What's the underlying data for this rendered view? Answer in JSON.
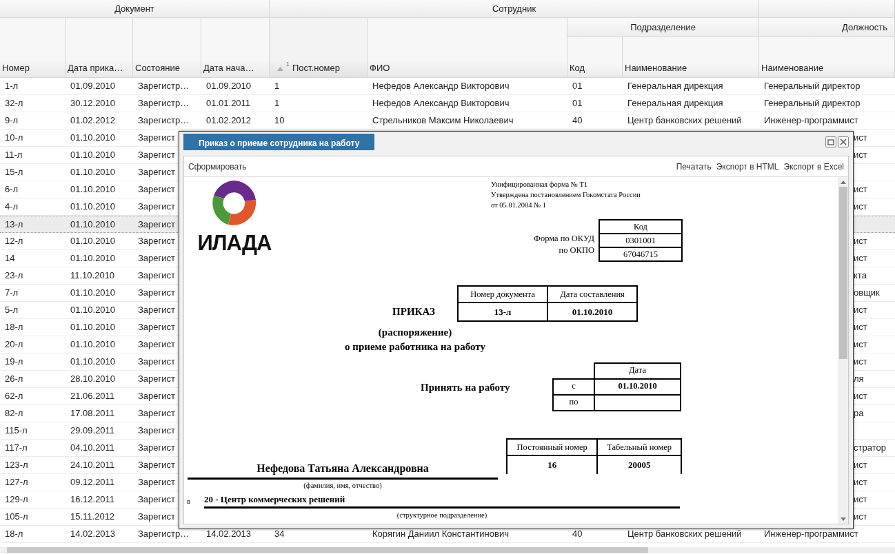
{
  "grid": {
    "groups": {
      "document": "Документ",
      "employee": "Сотрудник",
      "department": "Подразделение",
      "position": "Должность"
    },
    "columns": [
      {
        "label": "Номер",
        "sorted": false
      },
      {
        "label": "Дата прика…",
        "sorted": false
      },
      {
        "label": "Состояние",
        "sorted": false
      },
      {
        "label": "Дата нача…",
        "sorted": false
      },
      {
        "label": "Пост.номер",
        "sorted": true,
        "sort_order": "1"
      },
      {
        "label": "ФИО",
        "sorted": false
      },
      {
        "label": "Код",
        "sorted": false
      },
      {
        "label": "Наименование",
        "sorted": false
      },
      {
        "label": "Наименование",
        "sorted": false
      }
    ],
    "rows": [
      {
        "cells": [
          "1-л",
          "01.09.2010",
          "Зарегистр…",
          "01.09.2010",
          "1",
          "Нефедов Александр Викторович",
          "01",
          "Генеральная дирекция",
          "Генеральный директор"
        ],
        "selected": false
      },
      {
        "cells": [
          "32-л",
          "30.12.2010",
          "Зарегистр…",
          "01.01.2011",
          "1",
          "Нефедов Александр Викторович",
          "01",
          "Генеральная дирекция",
          "Генеральный директор"
        ],
        "selected": false
      },
      {
        "cells": [
          "9-л",
          "01.02.2012",
          "Зарегистр…",
          "01.02.2012",
          "10",
          "Стрельников Максим Николаевич",
          "40",
          "Центр банковских решений",
          "Инженер-программист"
        ],
        "selected": false
      },
      {
        "cells": [
          "10-л",
          "01.10.2010",
          "Зарегист"
        ],
        "tail": "ист",
        "selected": false
      },
      {
        "cells": [
          "11-л",
          "01.10.2010",
          "Зарегист"
        ],
        "tail": "ист",
        "selected": false
      },
      {
        "cells": [
          "15-л",
          "01.10.2010",
          "Зарегист"
        ],
        "selected": false
      },
      {
        "cells": [
          "6-л",
          "01.10.2010",
          "Зарегист"
        ],
        "tail": "ист",
        "selected": false
      },
      {
        "cells": [
          "4-л",
          "01.10.2010",
          "Зарегист"
        ],
        "tail": "ист",
        "selected": false
      },
      {
        "cells": [
          "13-л",
          "01.10.2010",
          "Зарегист"
        ],
        "selected": true
      },
      {
        "cells": [
          "12-л",
          "01.10.2010",
          "Зарегист"
        ],
        "tail": "ист",
        "selected": false
      },
      {
        "cells": [
          "14",
          "01.10.2010",
          "Зарегист"
        ],
        "tail": "ист",
        "selected": false
      },
      {
        "cells": [
          "23-л",
          "11.10.2010",
          "Зарегист"
        ],
        "tail": "кта",
        "selected": false
      },
      {
        "cells": [
          "7-л",
          "01.10.2010",
          "Зарегист"
        ],
        "tail": "овщик",
        "selected": false
      },
      {
        "cells": [
          "5-л",
          "01.10.2010",
          "Зарегист"
        ],
        "tail": "ист",
        "selected": false
      },
      {
        "cells": [
          "18-л",
          "01.10.2010",
          "Зарегист"
        ],
        "tail": "ист",
        "selected": false
      },
      {
        "cells": [
          "20-л",
          "01.10.2010",
          "Зарегист"
        ],
        "tail": "ист",
        "selected": false
      },
      {
        "cells": [
          "19-л",
          "01.10.2010",
          "Зарегист"
        ],
        "tail": "ист",
        "selected": false
      },
      {
        "cells": [
          "26-л",
          "28.10.2010",
          "Зарегист"
        ],
        "tail": "ля",
        "selected": false
      },
      {
        "cells": [
          "62-л",
          "21.06.2011",
          "Зарегист"
        ],
        "tail": "ист",
        "selected": false
      },
      {
        "cells": [
          "82-л",
          "17.08.2011",
          "Зарегист"
        ],
        "tail": "ра",
        "selected": false
      },
      {
        "cells": [
          "115-л",
          "29.09.2011",
          "Зарегист"
        ],
        "selected": false
      },
      {
        "cells": [
          "117-л",
          "04.10.2011",
          "Зарегист"
        ],
        "tail": "стратор",
        "selected": false
      },
      {
        "cells": [
          "123-л",
          "24.10.2011",
          "Зарегист"
        ],
        "tail": "ист",
        "selected": false
      },
      {
        "cells": [
          "127-л",
          "09.12.2011",
          "Зарегист"
        ],
        "tail": "ист",
        "selected": false
      },
      {
        "cells": [
          "129-л",
          "16.12.2011",
          "Зарегист"
        ],
        "tail": "ист",
        "selected": false
      },
      {
        "cells": [
          "105-л",
          "15.11.2012",
          "Зарегист"
        ],
        "tail": "ист",
        "selected": false
      },
      {
        "cells": [
          "18-л",
          "14.02.2013",
          "Зарегистр…",
          "14.02.2013",
          "34",
          "Корягин Даниил Константинович",
          "40",
          "Центр банковских решений",
          "Инженер-программист"
        ],
        "selected": false
      }
    ]
  },
  "modal": {
    "title": "Приказ о приеме сотрудника на работу",
    "toolbar": {
      "left": [
        "Сформировать"
      ],
      "right": [
        "Печатать",
        "Экспорт в HTML",
        "Экспорт в Excel"
      ]
    },
    "document": {
      "logo_text": "ИЛАДА",
      "form_note": [
        "Унифицированная форма № Т1",
        "Утверждена постановлением Гокомстата России",
        "от 05.01.2004 № 1"
      ],
      "codes": {
        "header": "Код",
        "rows": [
          {
            "label": "Форма по ОКУД",
            "value": "0301001"
          },
          {
            "label": "по ОКПО",
            "value": "67046715"
          }
        ]
      },
      "order_table": {
        "columns": [
          "Номер документа",
          "Дата составления"
        ],
        "values": [
          "13-л",
          "01.10.2010"
        ]
      },
      "title": "ПРИКАЗ",
      "subtitle": "(распоряжение)",
      "subject": "о приеме работника на работу",
      "hire": {
        "label": "Принять на работу",
        "header": "Дата",
        "rows": [
          {
            "label": "с",
            "value": "01.10.2010"
          },
          {
            "label": "по"
          }
        ]
      },
      "employee_table": {
        "columns": [
          "Постоянный номер",
          "Табельный номер"
        ],
        "values": [
          "16",
          "20005"
        ]
      },
      "employee_name": "Нефедова Татьяна Александровна",
      "employee_caption": "(фамилия, имя, отчество)",
      "department_prefix": "в",
      "department": "20 - Центр коммерческих решений",
      "department_caption": "(структурное подразделение)"
    }
  }
}
